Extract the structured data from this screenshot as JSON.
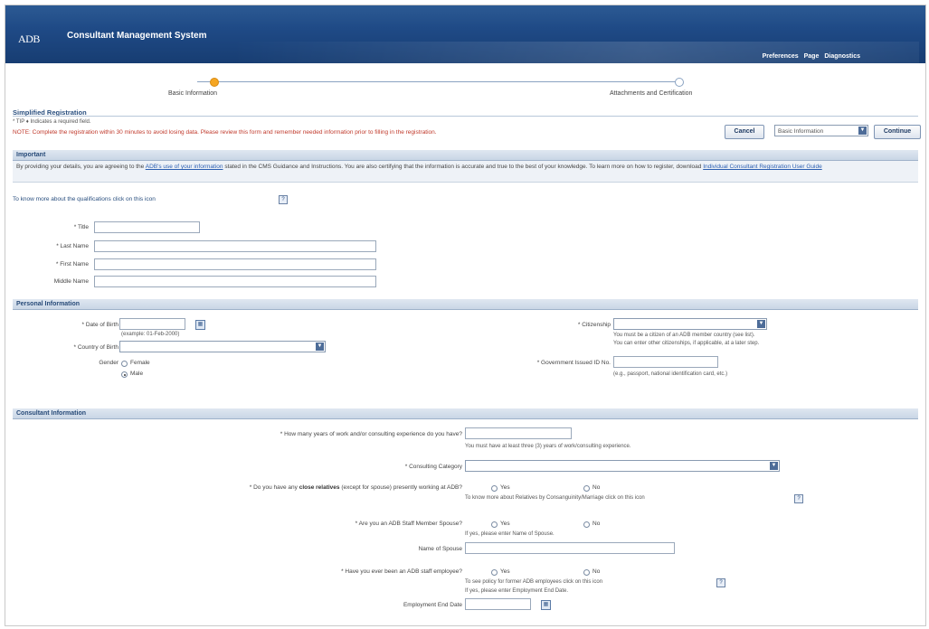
{
  "header": {
    "logo": "ADB",
    "title": "Consultant Management System",
    "links": [
      "Preferences",
      "Page",
      "Diagnostics"
    ]
  },
  "train": {
    "steps": [
      {
        "label": "Basic Information",
        "active": true
      },
      {
        "label": "Attachments and Certification",
        "active": false
      }
    ]
  },
  "page": {
    "title": "Simplified Registration",
    "required_note": "* TIP ♦ Indicates a required field.",
    "note": "NOTE: Complete the registration within 30 minutes to avoid losing data. Please review this form and remember needed information prior to filling in the registration."
  },
  "actions": {
    "cancel": "Cancel",
    "step_select": "Basic Information",
    "continue": "Continue"
  },
  "important": {
    "heading": "Important",
    "text_before": "By providing your details, you are agreeing to the ",
    "link1": "ADB's use of your information",
    "text_mid": " stated in the CMS Guidance and Instructions. You are also certifying that the information is accurate and true to the best of your knowledge. To learn more on how to register, download ",
    "link2": "Individual Consultant Registration User Guide",
    "qualifications": "To know more about the qualifications click on this icon"
  },
  "name_fields": {
    "title": "* Title",
    "last_name": "* Last Name",
    "first_name": "* First Name",
    "middle_name": "Middle Name"
  },
  "personal": {
    "heading": "Personal Information",
    "dob": "* Date of Birth",
    "dob_hint": "(example: 01-Feb-2000)",
    "country_birth": "* Country of Birth",
    "gender": "Gender",
    "female": "Female",
    "male": "Male",
    "citizenship": "* Citizenship",
    "citizenship_hint1": "You must be a citizen of an ADB member country (see list).",
    "citizenship_hint2": "You can enter other citizenships, if applicable, at a later step.",
    "gov_id": "* Government Issued ID No.",
    "gov_id_hint": "(e.g., passport, national identification card, etc.)"
  },
  "consultant": {
    "heading": "Consultant Information",
    "years_q": "* How many years of work and/or consulting experience do you have?",
    "years_hint": "You must have at least three (3) years of work/consulting experience.",
    "category": "* Consulting Category",
    "relatives_q_pre": "* Do you have any ",
    "relatives_q_bold": "close relatives",
    "relatives_q_post": " (except for spouse) presently working at ADB?",
    "relatives_hint": "To know more about Relatives by Consanguinity/Marriage click on this icon",
    "spouse_q": "* Are you an ADB Staff Member Spouse?",
    "spouse_hint": "If yes, please enter Name of Spouse.",
    "spouse_name": "Name of Spouse",
    "former_q": "* Have you ever been an ADB staff employee?",
    "former_hint1": "To see policy for former ADB employees click on this icon",
    "former_hint2": "If yes, please enter Employment End Date.",
    "end_date": "Employment End Date",
    "yes": "Yes",
    "no": "No"
  }
}
